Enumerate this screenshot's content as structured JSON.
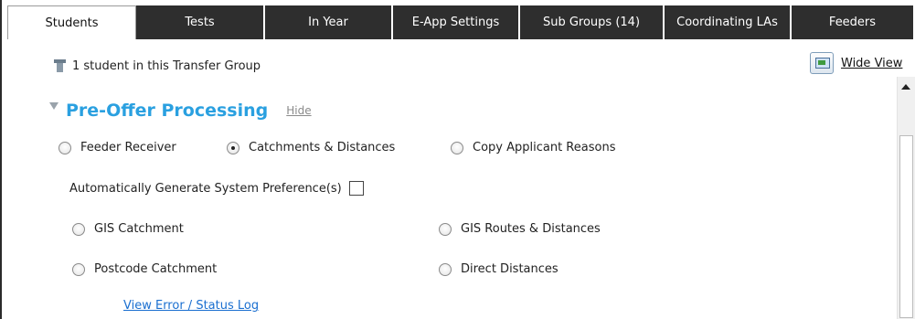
{
  "tabs": [
    {
      "label": "Students",
      "active": true
    },
    {
      "label": "Tests",
      "active": false
    },
    {
      "label": "In Year",
      "active": false
    },
    {
      "label": "E-App Settings",
      "active": false
    },
    {
      "label": "Sub Groups  (14)",
      "active": false
    },
    {
      "label": "Coordinating LAs",
      "active": false
    },
    {
      "label": "Feeders",
      "active": false
    }
  ],
  "wide_view": {
    "label": "Wide View"
  },
  "student_count": {
    "text": "1 student in this Transfer Group",
    "icon": "student-icon"
  },
  "section": {
    "title": "Pre-Offer Processing",
    "hide_label": "Hide"
  },
  "processing_mode": {
    "options": [
      "Feeder Receiver",
      "Catchments & Distances",
      "Copy Applicant Reasons"
    ],
    "selected": "Catchments & Distances"
  },
  "auto_generate": {
    "label": "Automatically Generate System Preference(s)",
    "checked": false
  },
  "methods": {
    "gis_catchment": "GIS Catchment",
    "gis_routes": "GIS Routes & Distances",
    "postcode_catchment": "Postcode Catchment",
    "direct_distances": "Direct Distances"
  },
  "error_link": {
    "label": "View Error / Status Log"
  },
  "colors": {
    "tab_bg": "#2e2e2e",
    "section_title": "#2aa0e0",
    "link": "#1a6fd0"
  }
}
